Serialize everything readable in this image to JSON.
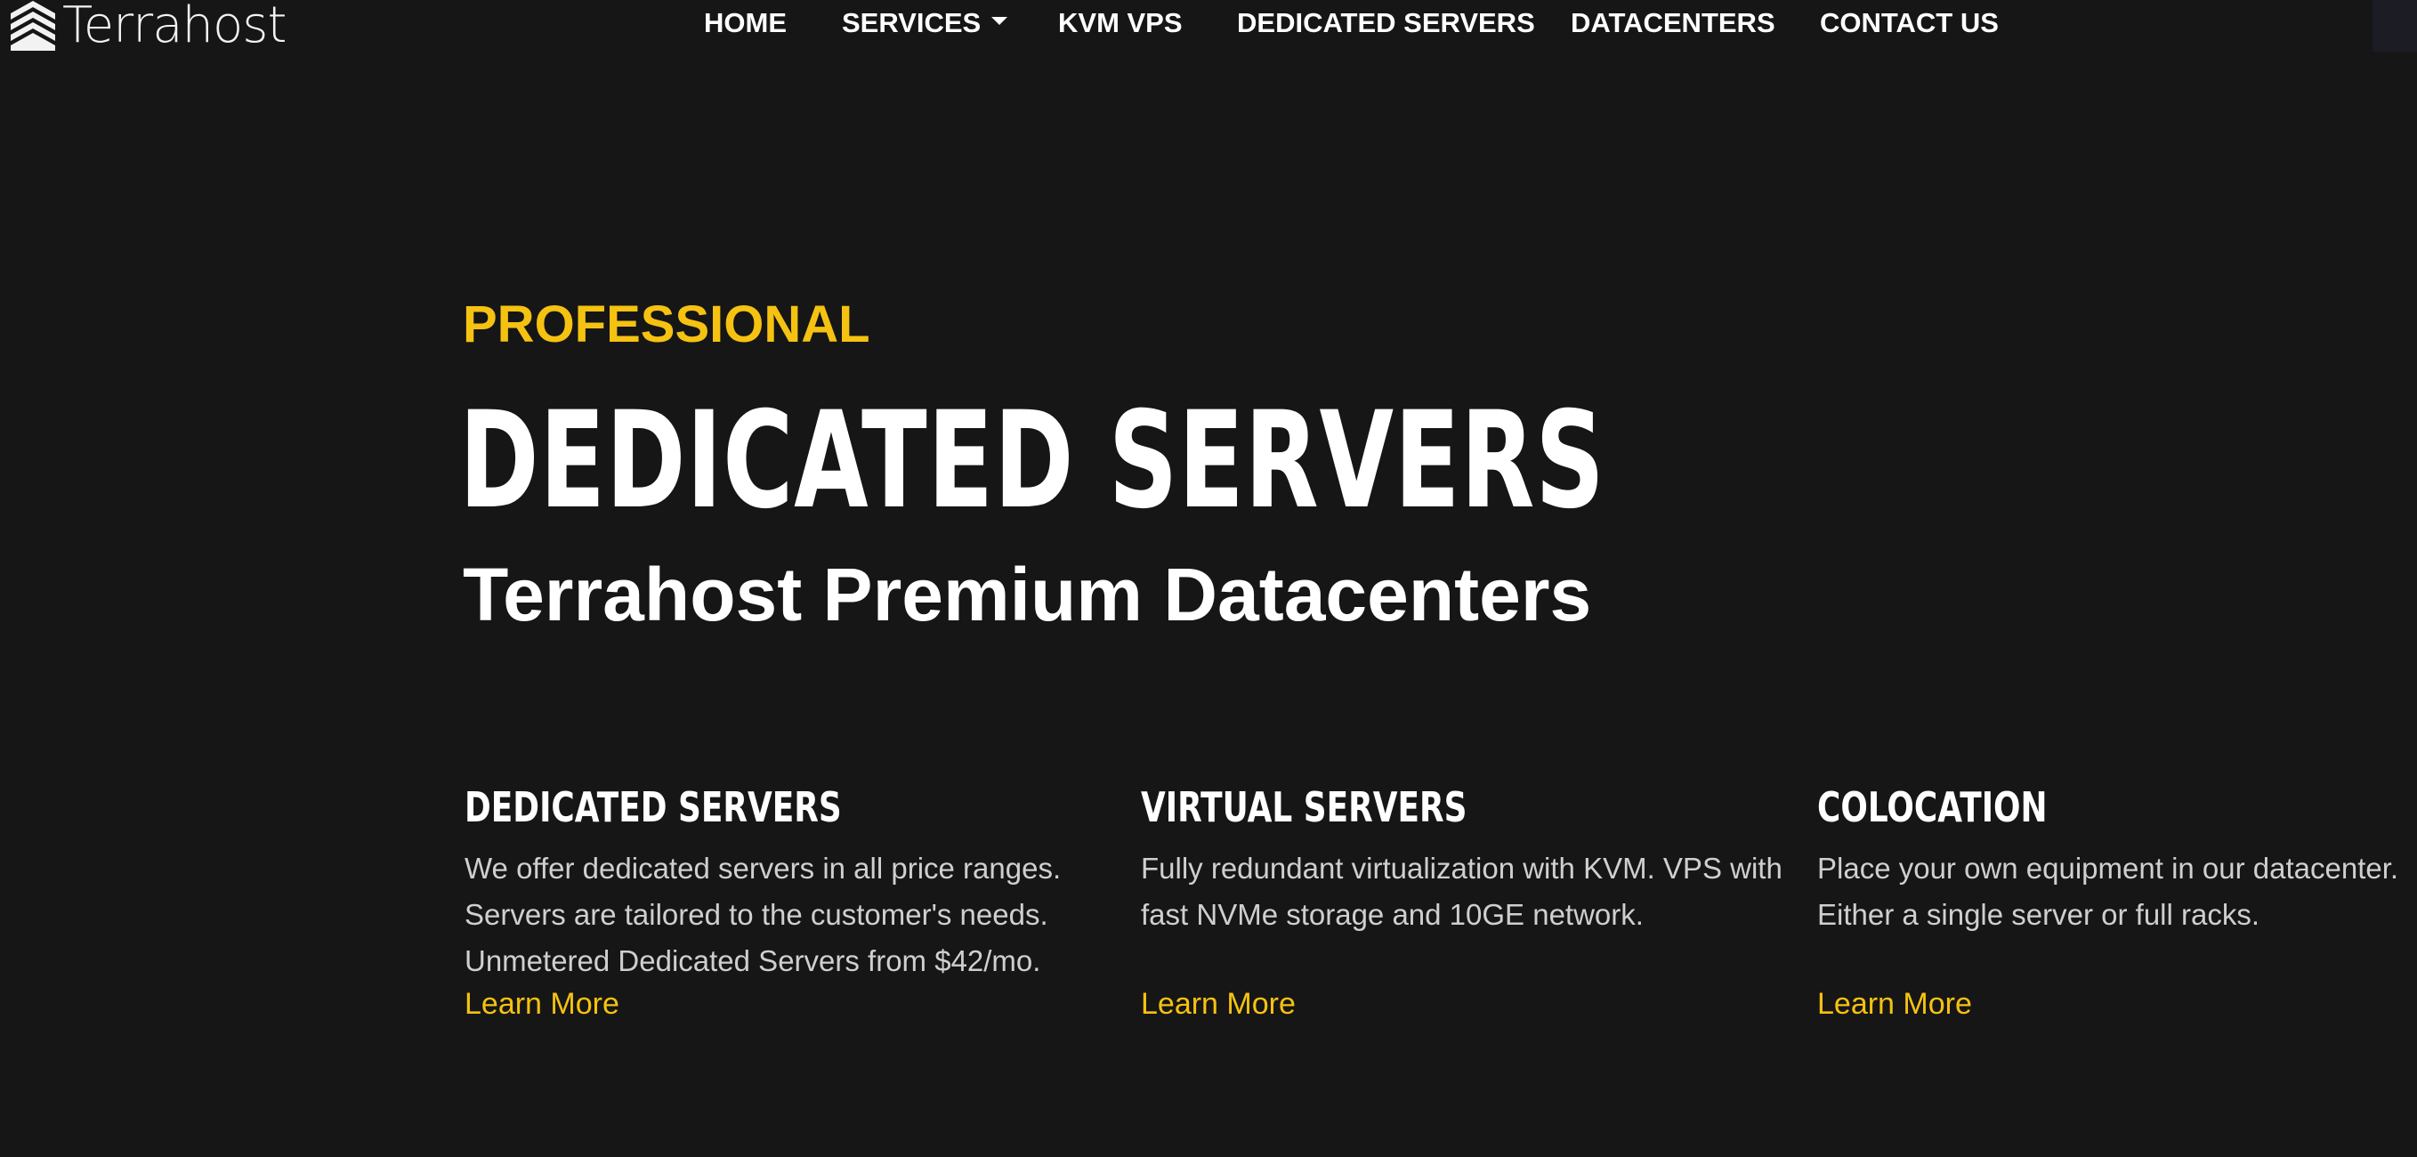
{
  "brand": {
    "name": "Terrahost",
    "logo_icon": "stacked-chevrons-logo",
    "accent_color": "#f5c211",
    "background_color": "#161616"
  },
  "nav": {
    "items": [
      {
        "label": "HOME"
      },
      {
        "label": "SERVICES",
        "has_dropdown": true
      },
      {
        "label": "KVM VPS"
      },
      {
        "label": "DEDICATED SERVERS"
      },
      {
        "label": "DATACENTERS"
      },
      {
        "label": "CONTACT US"
      }
    ]
  },
  "hero": {
    "eyebrow": "PROFESSIONAL",
    "title": "DEDICATED SERVERS",
    "subtitle": "Terrahost Premium Datacenters"
  },
  "features": [
    {
      "title": "DEDICATED SERVERS",
      "description_lines": [
        "We offer dedicated servers in all price ranges.",
        "Servers are tailored to the customer's needs.",
        "Unmetered Dedicated Servers from $42/mo."
      ],
      "link_label": "Learn More"
    },
    {
      "title": "VIRTUAL SERVERS",
      "description_lines": [
        "Fully redundant virtualization with KVM. VPS with",
        "fast NVMe storage and 10GE network."
      ],
      "link_label": "Learn More"
    },
    {
      "title": "COLOCATION",
      "description_lines": [
        "Place your own equipment in our datacenter.",
        "Either a single server or full racks."
      ],
      "link_label": "Learn More"
    }
  ]
}
